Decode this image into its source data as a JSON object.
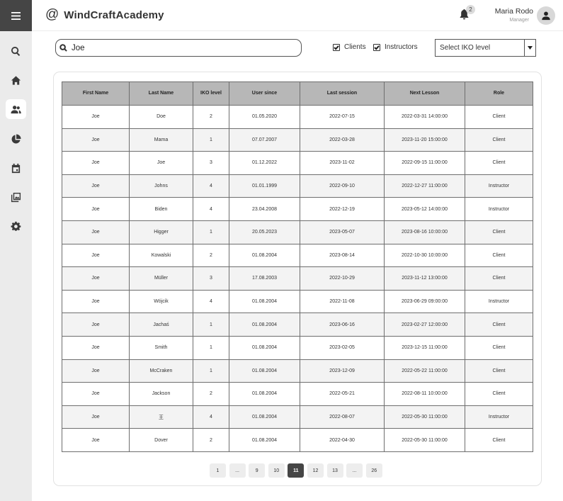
{
  "app": {
    "brand_symbol": "@",
    "brand_name": "WindCraftAcademy"
  },
  "sidebar": {
    "items": [
      {
        "icon": "search-icon",
        "active": false
      },
      {
        "icon": "home-icon",
        "active": false
      },
      {
        "icon": "users-icon",
        "active": true
      },
      {
        "icon": "pie-chart-icon",
        "active": false
      },
      {
        "icon": "calendar-icon",
        "active": false
      },
      {
        "icon": "gallery-icon",
        "active": false
      },
      {
        "icon": "gear-icon",
        "active": false
      }
    ]
  },
  "header": {
    "notification_count": "2",
    "user_name": "Maria Rodo",
    "user_role": "Manager"
  },
  "filters": {
    "search_value": "Joe",
    "clients_label": "Clients",
    "clients_checked": true,
    "instructors_label": "Instructors",
    "instructors_checked": true,
    "iko_select_value": "Select IKO level"
  },
  "table": {
    "columns": [
      "First Name",
      "Last Name",
      "IKO level",
      "User since",
      "Last session",
      "Next Lesson",
      "Role"
    ],
    "rows": [
      [
        "Joe",
        "Doe",
        "2",
        "01.05.2020",
        "2022-07-15",
        "2022-03-31 14:00:00",
        "Client"
      ],
      [
        "Joe",
        "Mama",
        "1",
        "07.07.2007",
        "2022-03-28",
        "2023-11-20 15:00:00",
        "Client"
      ],
      [
        "Joe",
        "Joe",
        "3",
        "01.12.2022",
        "2023-11-02",
        "2022-09-15 11:00:00",
        "Client"
      ],
      [
        "Joe",
        "Johns",
        "4",
        "01.01.1999",
        "2022-09-10",
        "2022-12-27 11:00:00",
        "Instructor"
      ],
      [
        "Joe",
        "Biden",
        "4",
        "23.04.2008",
        "2022-12-19",
        "2023-05-12 14:00:00",
        "Instructor"
      ],
      [
        "Joe",
        "Higger",
        "1",
        "20.05.2023",
        "2023-05-07",
        "2023-08-16 10:00:00",
        "Client"
      ],
      [
        "Joe",
        "Kowalski",
        "2",
        "01.08.2004",
        "2023-08-14",
        "2022-10-30 10:00:00",
        "Client"
      ],
      [
        "Joe",
        "Müller",
        "3",
        "17.08.2003",
        "2022-10-29",
        "2023-11-12 13:00:00",
        "Client"
      ],
      [
        "Joe",
        "Wójcik",
        "4",
        "01.08.2004",
        "2022-11-08",
        "2023-06-29 09:00:00",
        "Instructor"
      ],
      [
        "Joe",
        "Jachaś",
        "1",
        "01.08.2004",
        "2023-06-16",
        "2023-02-27 12:00:00",
        "Client"
      ],
      [
        "Joe",
        "Smith",
        "1",
        "01.08.2004",
        "2023-02-05",
        "2023-12-15 11:00:00",
        "Client"
      ],
      [
        "Joe",
        "McCraken",
        "1",
        "01.08.2004",
        "2023-12-09",
        "2022-05-22 11:00:00",
        "Client"
      ],
      [
        "Joe",
        "Jackson",
        "2",
        "01.08.2004",
        "2022-05-21",
        "2022-08-11 10:00:00",
        "Client"
      ],
      [
        "Joe",
        "王",
        "4",
        "01.08.2004",
        "2022-08-07",
        "2022-05-30 11:00:00",
        "Instructor"
      ],
      [
        "Joe",
        "Dover",
        "2",
        "01.08.2004",
        "2022-04-30",
        "2022-05-30 11:00:00",
        "Client"
      ]
    ]
  },
  "pagination": {
    "pages": [
      "1",
      "...",
      "9",
      "10",
      "11",
      "12",
      "13",
      "...",
      "26"
    ],
    "current": "11"
  }
}
